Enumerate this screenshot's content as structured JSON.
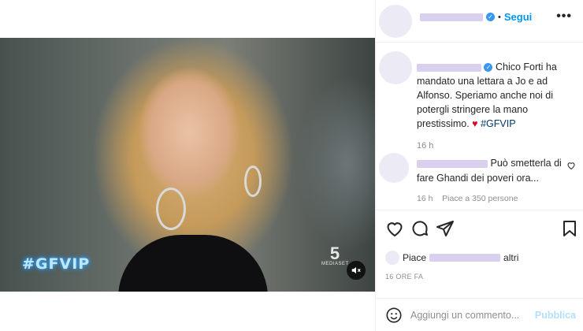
{
  "post": {
    "follow_label": "Segui",
    "separator": "•",
    "more_label": "•••",
    "caption_text": "Chico Forti ha mandato una lettara a Jo e ad Alfonso. Speriamo anche noi di potergli stringere la mano prestissimo.",
    "caption_heart": "♥",
    "caption_hashtag": "#GFVIP",
    "caption_time": "16 h"
  },
  "video": {
    "overlay_hashtag": "#GFVIP",
    "channel_number": "5",
    "channel_name": "MEDIASET"
  },
  "comment": {
    "text": "Può smetterla di fare Ghandi dei poveri ora...",
    "time": "16 h",
    "likes": "Piace a 350 persone"
  },
  "likes_summary": {
    "prefix": "Piace",
    "suffix": "altri"
  },
  "post_age": "16 ORE FA",
  "add_comment": {
    "placeholder": "Aggiungi un commento...",
    "publish_label": "Pubblica"
  },
  "colors": {
    "accent": "#0095f6",
    "heart": "#d10b2c",
    "verified": "#3897f0"
  }
}
